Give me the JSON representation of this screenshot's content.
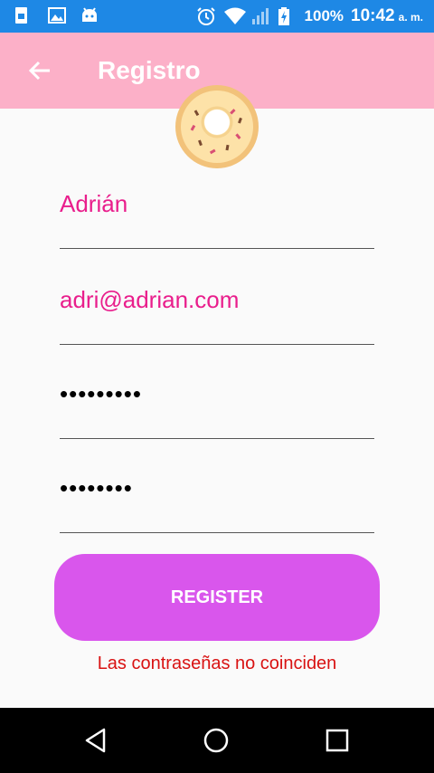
{
  "status_bar": {
    "battery": "100%",
    "time": "10:42",
    "ampm": "a. m.",
    "icons": [
      "sim-card-icon",
      "image-icon",
      "android-icon",
      "alarm-icon",
      "wifi-icon",
      "signal-icon",
      "battery-charging-icon"
    ]
  },
  "app_bar": {
    "title": "Registro",
    "back_icon": "arrow-back-icon",
    "background": "#fcb0c8"
  },
  "form": {
    "name_value": "Adrián",
    "email_value": "adri@adrian.com",
    "password_value": "•••••••••",
    "confirm_password_value": "••••••••",
    "text_color": "#e91e8c"
  },
  "register_button": {
    "label": "REGISTER",
    "color": "#d956ec"
  },
  "error_message": "Las contraseñas no coinciden",
  "nav_bar": {
    "icons": [
      "triangle-back-icon",
      "circle-home-icon",
      "square-recents-icon"
    ]
  }
}
